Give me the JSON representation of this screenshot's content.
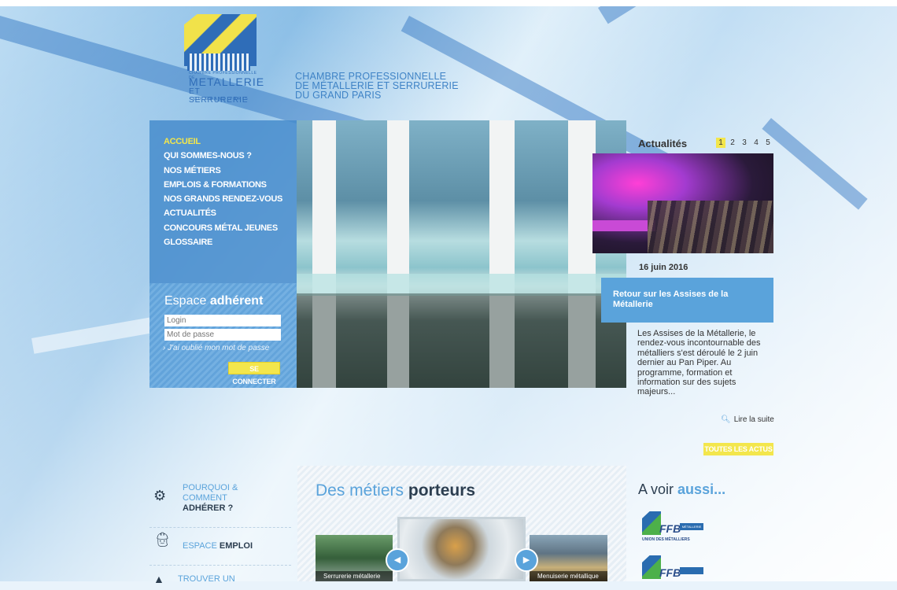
{
  "header": {
    "logo_lines": [
      "CHAMBRE PROFESSIONNELLE DE",
      "METALLERIE",
      "ET SERRURERIE",
      "DU GRAND PARIS"
    ],
    "brand_lines": [
      "CHAMBRE PROFESSIONNELLE",
      "DE MÉTALLERIE ET SERRURERIE",
      "DU GRAND PARIS"
    ]
  },
  "nav": {
    "items": [
      {
        "label": "ACCUEIL",
        "active": true
      },
      {
        "label": "QUI SOMMES-NOUS ?"
      },
      {
        "label": "NOS MÉTIERS"
      },
      {
        "label": "EMPLOIS & FORMATIONS"
      },
      {
        "label": "NOS GRANDS RENDEZ-VOUS"
      },
      {
        "label": "ACTUALITÉS"
      },
      {
        "label": "CONCOURS MÉTAL JEUNES"
      },
      {
        "label": "GLOSSAIRE"
      }
    ]
  },
  "member": {
    "title_prefix": "Espace",
    "title_bold": "adhérent",
    "login_placeholder": "Login",
    "password_placeholder": "Mot de passe",
    "forgot": "› J'ai oublié mon mot de passe",
    "connect_label": "SE CONNECTER"
  },
  "news": {
    "heading": "Actualités",
    "pages": [
      "1",
      "2",
      "3",
      "4",
      "5"
    ],
    "current_page": "1",
    "date": "16 juin 2016",
    "title": "Retour sur les Assises de la Métallerie",
    "body": "Les Assises de la Métallerie, le rendez-vous incontournable des métalliers s'est déroulé le 2 juin dernier au Pan Piper. Au programme, formation et information sur des sujets majeurs...",
    "read_more": "Lire la suite",
    "all_news": "TOUTES LES ACTUS"
  },
  "links": {
    "adherer": {
      "line1": "POURQUOI &",
      "line2": "COMMENT",
      "line3": "ADHÉRER ?"
    },
    "emploi": {
      "prefix": "ESPACE",
      "bold": "EMPLOI"
    },
    "trouver": {
      "label": "TROUVER UN"
    }
  },
  "metiers": {
    "title_prefix": "Des métiers",
    "title_bold": "porteurs",
    "thumbs": [
      {
        "caption": "Serrurerie métallerie"
      },
      {
        "caption": ""
      },
      {
        "caption": "Menuiserie métallique"
      }
    ],
    "prev_label": "◀",
    "next_label": "▶"
  },
  "aussi": {
    "title_prefix": "A voir",
    "title_bold": "aussi...",
    "logos": [
      {
        "name": "FFB",
        "tag": "MÉTALLERIE",
        "sub": "UNION DES MÉTALLIERS"
      },
      {
        "name": "FFB",
        "tag": "",
        "sub": ""
      }
    ]
  },
  "colors": {
    "accent_blue": "#5aa3db",
    "yellow": "#f3e64c",
    "dark_text": "#2c3e50"
  }
}
